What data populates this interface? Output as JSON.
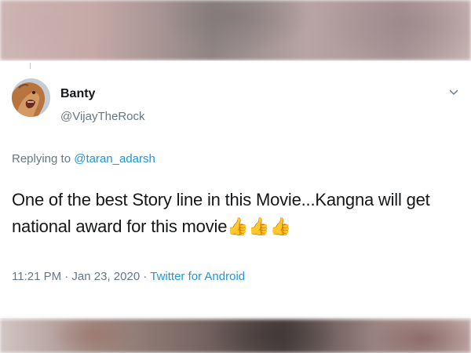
{
  "tweet": {
    "display_name": "Banty",
    "handle": "@VijayTheRock",
    "replying_prefix": "Replying to ",
    "replying_mention": "@taran_adarsh",
    "text": "One of the best Story line in this Movie...Kangna will get national award for this movie👍👍👍",
    "timestamp": "11:21 PM · Jan 23, 2020 · ",
    "source": "Twitter for Android",
    "avatar_icon": "lion-avatar-icon",
    "menu_icon": "chevron-down-icon"
  }
}
